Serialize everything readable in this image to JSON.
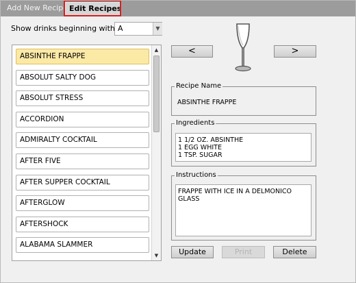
{
  "tabs": {
    "add_new": "Add New Recipe",
    "edit": "Edit Recipes"
  },
  "filter": {
    "label": "Show drinks beginning with:",
    "selected_letter": "A"
  },
  "drinks": [
    "ABSINTHE FRAPPE",
    "ABSOLUT SALTY DOG",
    "ABSOLUT STRESS",
    "ACCORDION",
    "ADMIRALTY COCKTAIL",
    "AFTER FIVE",
    "AFTER SUPPER COCKTAIL",
    "AFTERGLOW",
    "AFTERSHOCK",
    "ALABAMA SLAMMER"
  ],
  "selected_drink_index": 0,
  "navigation": {
    "prev_label": "<",
    "next_label": ">"
  },
  "icons": {
    "glass": "champagne-flute-icon"
  },
  "recipe": {
    "name_title": "Recipe Name",
    "name": "ABSINTHE FRAPPE",
    "ingredients_title": "Ingredients",
    "ingredients": [
      "1 1/2 OZ. ABSINTHE",
      "1 EGG WHITE",
      "1 TSP. SUGAR"
    ],
    "instructions_title": "Instructions",
    "instructions": "FRAPPE WITH ICE IN A DELMONICO GLASS"
  },
  "actions": {
    "update": "Update",
    "print": "Print",
    "delete": "Delete"
  },
  "colors": {
    "tab_bar": "#9c9c9c",
    "highlight_outline": "#d61f1f",
    "selected_item": "#fbe9a6"
  }
}
